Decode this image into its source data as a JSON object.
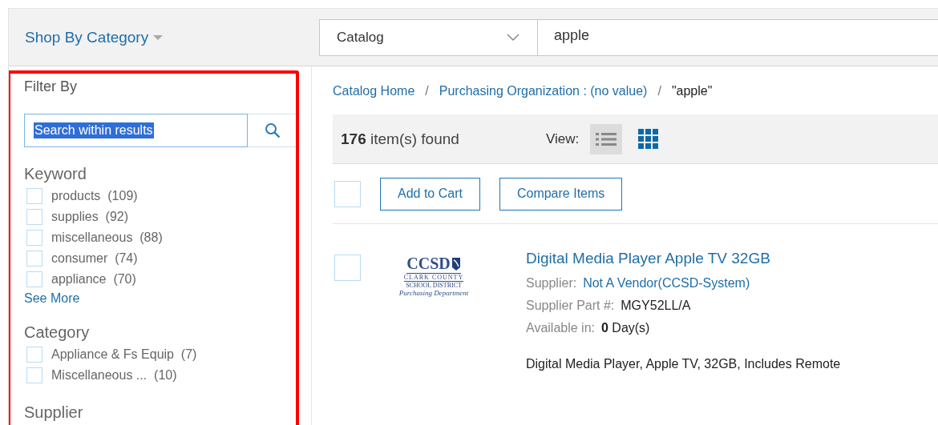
{
  "header": {
    "category_menu": "Shop By Category",
    "search_scope": "Catalog",
    "search_value": "apple"
  },
  "sidebar": {
    "title": "Filter By",
    "search": {
      "value": "Search within results",
      "text_selected": true
    },
    "groups": [
      {
        "title": "Keyword",
        "items": [
          {
            "label": "products",
            "count": "(109)",
            "checked": false
          },
          {
            "label": "supplies",
            "count": "(92)",
            "checked": false
          },
          {
            "label": "miscellaneous",
            "count": "(88)",
            "checked": false
          },
          {
            "label": "consumer",
            "count": "(74)",
            "checked": false
          },
          {
            "label": "appliance",
            "count": "(70)",
            "checked": false
          }
        ],
        "more": "See More"
      },
      {
        "title": "Category",
        "items": [
          {
            "label": "Appliance & Fs Equip",
            "count": "(7)",
            "checked": false
          },
          {
            "label": "Miscellaneous ...",
            "count": "(10)",
            "checked": false
          }
        ]
      },
      {
        "title": "Supplier"
      }
    ],
    "highlighted": true
  },
  "breadcrumb_separator": "/",
  "breadcrumb": [
    {
      "label": "Catalog Home",
      "kind": "link"
    },
    {
      "label": "Purchasing Organization : (no value)",
      "kind": "link"
    },
    {
      "label": "\"apple\"",
      "kind": "current"
    }
  ],
  "results": {
    "count": "176",
    "count_label": "item(s) found",
    "view_label": "View:",
    "views": [
      {
        "kind": "list",
        "selected": true
      },
      {
        "kind": "grid",
        "selected": false
      }
    ]
  },
  "actions": {
    "select_all_checked": false,
    "buttons": [
      "Add to Cart",
      "Compare Items"
    ]
  },
  "products": [
    {
      "checked": false,
      "logo": {
        "initials": "CCSD",
        "line1": "CLARK COUNTY",
        "line2": "SCHOOL DISTRICT",
        "line3": "Purchasing Department"
      },
      "title": "Digital Media Player Apple TV 32GB",
      "details": [
        {
          "label": "Supplier:",
          "value": "Not A Vendor(CCSD-System)",
          "kind": "link"
        },
        {
          "label": "Supplier Part #:",
          "value": "MGY52LL/A",
          "kind": "plain"
        },
        {
          "label": "Available in:",
          "value": "**0** Day(s)",
          "kind": "plain"
        }
      ],
      "description": "Digital Media Player, Apple TV, 32GB, Includes Remote"
    }
  ]
}
